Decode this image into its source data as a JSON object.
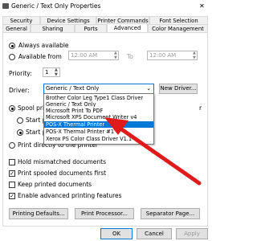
{
  "window": {
    "title": "Generic / Text Only Properties",
    "close": "✕"
  },
  "tabs": [
    {
      "label": "Security"
    },
    {
      "label": "Device Settings"
    },
    {
      "label": "Printer Commands"
    },
    {
      "label": "Font Selection"
    },
    {
      "label": "General"
    },
    {
      "label": "Sharing"
    },
    {
      "label": "Ports"
    },
    {
      "label": "Advanced"
    },
    {
      "label": "Color Management"
    }
  ],
  "availability": {
    "always_label": "Always available",
    "from_label": "Available from",
    "from_time": "12:00 AM",
    "to_label": "To",
    "to_time": "12:00 AM"
  },
  "priority": {
    "label": "Priority:",
    "value": "1"
  },
  "driver": {
    "label": "Driver:",
    "selected": "Generic / Text Only",
    "new_driver_label": "New Driver..."
  },
  "driver_options": [
    "Brother Color Leg Type1 Class Driver",
    "Generic / Text Only",
    "Microsoft Print To PDF",
    "Microsoft XPS Document Writer v4",
    "POS-X Thermal Printer",
    "POS-X Thermal Printer #1",
    "Xerox PS Color Class Driver V1.1"
  ],
  "driver_highlighted_index": 4,
  "spool": {
    "spool_label": "Spool print",
    "spool_suffix": "r",
    "start_after_label": "Start pri",
    "start_immediately_label": "Start pri",
    "direct_label": "Print directly to the printer"
  },
  "options": [
    {
      "label": "Hold mismatched documents",
      "checked": false
    },
    {
      "label": "Print spooled documents first",
      "checked": true
    },
    {
      "label": "Keep printed documents",
      "checked": false
    },
    {
      "label": "Enable advanced printing features",
      "checked": true
    }
  ],
  "buttons": {
    "printing_defaults": "Printing Defaults...",
    "print_processor": "Print Processor...",
    "separator_page": "Separator Page...",
    "ok": "OK",
    "cancel": "Cancel",
    "apply": "Apply"
  },
  "colors": {
    "accent": "#0078d7",
    "arrow": "#e01b1b"
  }
}
